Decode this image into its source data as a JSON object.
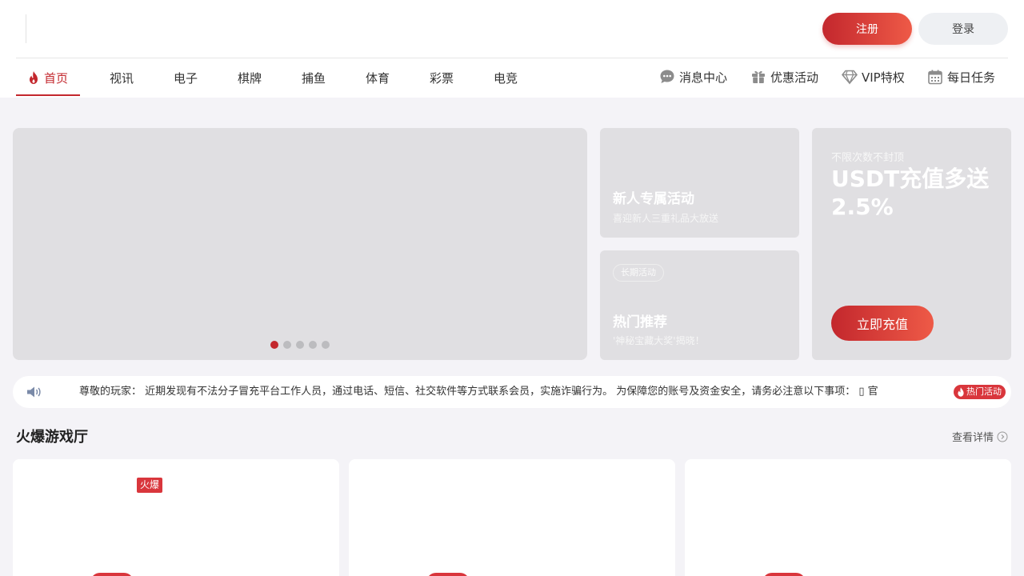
{
  "header": {
    "register_label": "注册",
    "login_label": "登录"
  },
  "nav": {
    "left": [
      {
        "label": "首页",
        "active": true
      },
      {
        "label": "视讯"
      },
      {
        "label": "电子"
      },
      {
        "label": "棋牌"
      },
      {
        "label": "捕鱼"
      },
      {
        "label": "体育"
      },
      {
        "label": "彩票"
      },
      {
        "label": "电竞"
      }
    ],
    "right": [
      {
        "label": "消息中心",
        "icon": "chat-bubble-icon"
      },
      {
        "label": "优惠活动",
        "icon": "gift-icon"
      },
      {
        "label": "VIP特权",
        "icon": "diamond-icon"
      },
      {
        "label": "每日任务",
        "icon": "calendar-icon"
      }
    ]
  },
  "banner": {
    "slides_count": 5,
    "active_slide": 1
  },
  "promos": {
    "newcomer": {
      "title": "新人专属活动",
      "subtitle": "喜迎新人三重礼品大放送"
    },
    "hot": {
      "tag": "长期活动",
      "title": "热门推荐",
      "subtitle": "'神秘宝藏大奖'揭晓！"
    },
    "usdt": {
      "small": "不限次数不封顶",
      "big": "USDT充值多送2.5%",
      "button": "立即充值"
    }
  },
  "notice": {
    "text": "尊敬的玩家： 近期发现有不法分子冒充平台工作人员，通过电话、短信、社交软件等方式联系会员，实施诈骗行为。 为保障您的账号及资金安全，请务必注意以下事项： ▯ 官",
    "hot_badge": "热门活动"
  },
  "section": {
    "title": "火爆游戏厅",
    "view_more": "查看详情",
    "hot_tag": "火爆"
  },
  "colors": {
    "accent": "#c3272d",
    "accent_light": "#ee5a47",
    "background": "#f4f3f7",
    "placeholder": "#e0dfe2"
  }
}
